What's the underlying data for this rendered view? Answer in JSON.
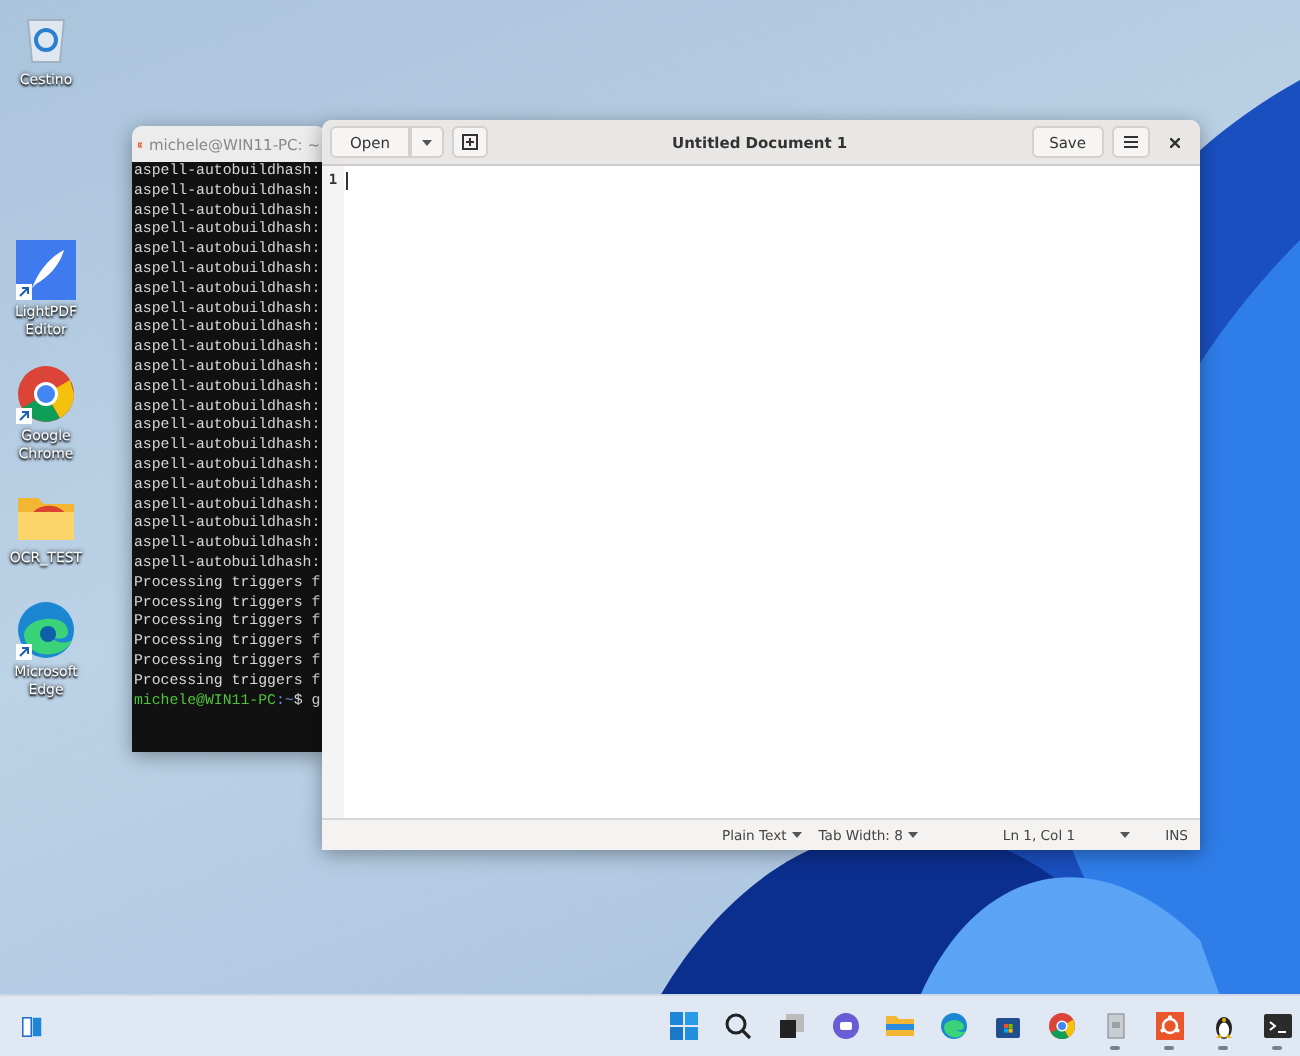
{
  "desktop_icons": [
    {
      "kind": "recycle-bin",
      "label": "Cestino",
      "shortcut": false
    },
    {
      "kind": "pdf-editor",
      "label": "LightPDF Editor",
      "shortcut": true
    },
    {
      "kind": "chrome",
      "label": "Google Chrome",
      "shortcut": true
    },
    {
      "kind": "folder",
      "label": "OCR_TEST",
      "shortcut": false
    },
    {
      "kind": "edge",
      "label": "Microsoft Edge",
      "shortcut": true
    }
  ],
  "terminal": {
    "title": "michele@WIN11-PC: ~",
    "lines": [
      "aspell-autobuildhash:",
      "aspell-autobuildhash:",
      "aspell-autobuildhash:",
      "aspell-autobuildhash:",
      "aspell-autobuildhash:",
      "aspell-autobuildhash:",
      "aspell-autobuildhash:",
      "aspell-autobuildhash:",
      "aspell-autobuildhash:",
      "aspell-autobuildhash:",
      "aspell-autobuildhash:",
      "aspell-autobuildhash:",
      "aspell-autobuildhash:",
      "aspell-autobuildhash:",
      "aspell-autobuildhash:",
      "aspell-autobuildhash:",
      "aspell-autobuildhash:",
      "aspell-autobuildhash:",
      "aspell-autobuildhash:",
      "aspell-autobuildhash:",
      "aspell-autobuildhash:",
      "Processing triggers f",
      "Processing triggers f",
      "Processing triggers f",
      "Processing triggers f",
      "Processing triggers f",
      "Processing triggers f"
    ],
    "prompt": {
      "user_host": "michele@WIN11-PC",
      "path": ":~",
      "command": "$ g"
    }
  },
  "editor": {
    "open_button": "Open",
    "title": "Untitled Document 1",
    "save_button": "Save",
    "line_number": "1",
    "status": {
      "language": "Plain Text",
      "tab_width": "Tab Width: 8",
      "position": "Ln 1, Col 1",
      "mode": "INS"
    }
  },
  "taskbar": {
    "apps": [
      {
        "kind": "start",
        "running": false
      },
      {
        "kind": "search",
        "running": false
      },
      {
        "kind": "task-view",
        "running": false
      },
      {
        "kind": "chat",
        "running": false
      },
      {
        "kind": "files",
        "running": false
      },
      {
        "kind": "edge",
        "running": false
      },
      {
        "kind": "store",
        "running": false
      },
      {
        "kind": "chrome",
        "running": false
      },
      {
        "kind": "archive",
        "running": true
      },
      {
        "kind": "ubuntu",
        "running": true
      },
      {
        "kind": "linux",
        "running": true
      },
      {
        "kind": "terminal",
        "running": true
      }
    ]
  }
}
